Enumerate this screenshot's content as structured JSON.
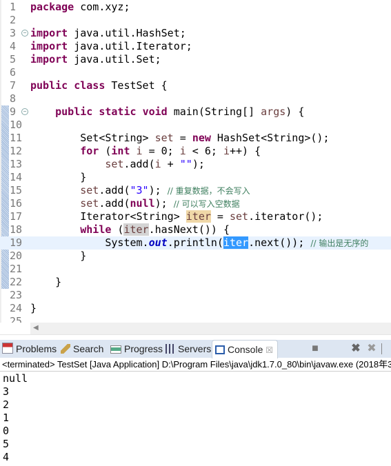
{
  "editor": {
    "lines": [
      [
        {
          "t": "package",
          "c": "kw"
        },
        {
          "t": " com.xyz;"
        }
      ],
      [],
      [
        {
          "t": "import",
          "c": "kw"
        },
        {
          "t": " java.util.HashSet;"
        }
      ],
      [
        {
          "t": "import",
          "c": "kw"
        },
        {
          "t": " java.util.Iterator;"
        }
      ],
      [
        {
          "t": "import",
          "c": "kw"
        },
        {
          "t": " java.util.Set;"
        }
      ],
      [],
      [
        {
          "t": "public",
          "c": "kw"
        },
        {
          "t": " "
        },
        {
          "t": "class",
          "c": "kw"
        },
        {
          "t": " TestSet {"
        }
      ],
      [],
      [
        {
          "t": "    "
        },
        {
          "t": "public",
          "c": "kw"
        },
        {
          "t": " "
        },
        {
          "t": "static",
          "c": "kw"
        },
        {
          "t": " "
        },
        {
          "t": "void",
          "c": "kw"
        },
        {
          "t": " main(String[] "
        },
        {
          "t": "args",
          "c": "lv"
        },
        {
          "t": ") {"
        }
      ],
      [],
      [
        {
          "t": "        Set<String> "
        },
        {
          "t": "set",
          "c": "lv"
        },
        {
          "t": " = "
        },
        {
          "t": "new",
          "c": "kw"
        },
        {
          "t": " HashSet<String>();"
        }
      ],
      [
        {
          "t": "        "
        },
        {
          "t": "for",
          "c": "kw"
        },
        {
          "t": " ("
        },
        {
          "t": "int",
          "c": "kw"
        },
        {
          "t": " "
        },
        {
          "t": "i",
          "c": "lv"
        },
        {
          "t": " = 0; "
        },
        {
          "t": "i",
          "c": "lv"
        },
        {
          "t": " < 6; "
        },
        {
          "t": "i",
          "c": "lv"
        },
        {
          "t": "++) {"
        }
      ],
      [
        {
          "t": "            "
        },
        {
          "t": "set",
          "c": "lv"
        },
        {
          "t": ".add("
        },
        {
          "t": "i",
          "c": "lv"
        },
        {
          "t": " + "
        },
        {
          "t": "\"\"",
          "c": "str"
        },
        {
          "t": ");"
        }
      ],
      [
        {
          "t": "        }"
        }
      ],
      [
        {
          "t": "        "
        },
        {
          "t": "set",
          "c": "lv"
        },
        {
          "t": ".add("
        },
        {
          "t": "\"3\"",
          "c": "str"
        },
        {
          "t": "); "
        },
        {
          "t": "// ",
          "c": "cm"
        },
        {
          "t": "重复数据，不会写入",
          "c": "cm"
        }
      ],
      [
        {
          "t": "        "
        },
        {
          "t": "set",
          "c": "lv"
        },
        {
          "t": ".add("
        },
        {
          "t": "null",
          "c": "kw"
        },
        {
          "t": "); "
        },
        {
          "t": "// ",
          "c": "cm"
        },
        {
          "t": "可以写入空数据",
          "c": "cm"
        }
      ],
      [
        {
          "t": "        Iterator<String> "
        },
        {
          "t": "iter",
          "c": "lv hl-write"
        },
        {
          "t": " = "
        },
        {
          "t": "set",
          "c": "lv"
        },
        {
          "t": ".iterator();"
        }
      ],
      [
        {
          "t": "        "
        },
        {
          "t": "while",
          "c": "kw"
        },
        {
          "t": " ("
        },
        {
          "t": "iter",
          "c": "lv hl-read"
        },
        {
          "t": ".hasNext()) {"
        }
      ],
      [
        {
          "t": "            System."
        },
        {
          "t": "out",
          "c": "sf"
        },
        {
          "t": ".println("
        },
        {
          "t": "iter",
          "c": "hl-sel"
        },
        {
          "t": ".next()); "
        },
        {
          "t": "// ",
          "c": "cm"
        },
        {
          "t": "输出是无序的",
          "c": "cm"
        }
      ],
      [
        {
          "t": "        }"
        }
      ],
      [],
      [
        {
          "t": "    }"
        }
      ],
      [],
      [
        {
          "t": "}"
        }
      ],
      []
    ],
    "current_line": 19,
    "fold_lines": [
      3,
      9
    ]
  },
  "views": {
    "tabs": [
      {
        "label": "Problems",
        "icon": "problems-icon"
      },
      {
        "label": "Search",
        "icon": "search-icon"
      },
      {
        "label": "Progress",
        "icon": "progress-icon"
      },
      {
        "label": "Servers",
        "icon": "servers-icon"
      },
      {
        "label": "Console",
        "icon": "console-icon",
        "active": true
      }
    ],
    "close_glyph": "☒"
  },
  "console": {
    "status": "<terminated> TestSet [Java Application] D:\\Program Files\\java\\jdk1.7.0_80\\bin\\javaw.exe (2018年3",
    "output": [
      "null",
      "3",
      "2",
      "1",
      "0",
      "5",
      "4"
    ]
  }
}
